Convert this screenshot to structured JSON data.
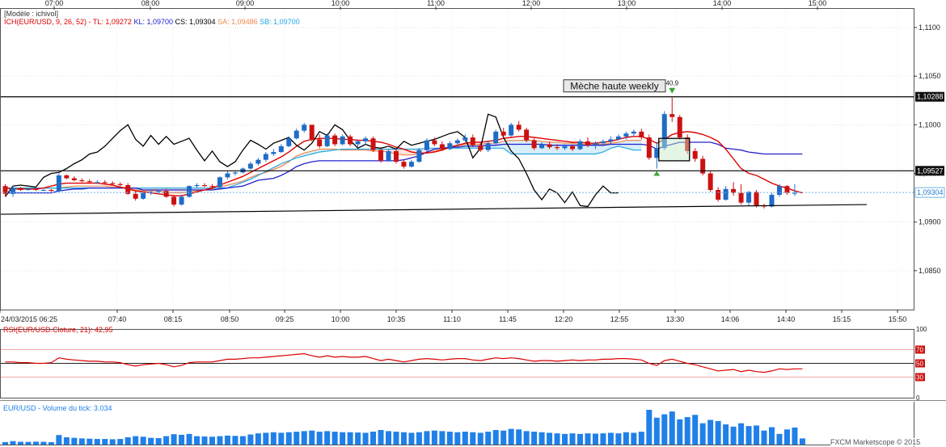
{
  "header": {
    "model_label": "[Modèle : ichivol]",
    "ichimoku_prefix": "ICH(EUR/USD, 9, 26, 52) -",
    "tl": "TL: 1,09272",
    "kl": "KL: 1,09700",
    "cs": "CS: 1,09304",
    "sa": "SA: 1,09486",
    "sb": "SB: 1,09700"
  },
  "colors": {
    "tenkan": "#dd0000",
    "kijun": "#2222cc",
    "chikou": "#000000",
    "span_a": "#f08850",
    "span_b": "#22a8e0",
    "bull": "#1e6cc8",
    "bear": "#cc1111",
    "rsi": "#dd0000",
    "volume": "#2080e8",
    "kumo_bull": "#d8eef8",
    "kumo_bear": "#fbe2dc"
  },
  "annotation": {
    "box_label": "Mèche haute weekly",
    "fractal_label": "40,9"
  },
  "top_time_labels": [
    "07:00",
    "08:00",
    "09:00",
    "10:00",
    "11:00",
    "12:00",
    "13:00",
    "14:00",
    "15:00"
  ],
  "bottom_time_labels": [
    "24/03/2015 06:25",
    "07:40",
    "08:15",
    "08:50",
    "09:25",
    "10:00",
    "10:35",
    "11:10",
    "11:45",
    "12:20",
    "12:55",
    "13:30",
    "14:06",
    "14:40",
    "15:15",
    "15:50"
  ],
  "price_axis": {
    "ylim": [
      1.081,
      1.112
    ],
    "ticks": [
      "1,1100",
      "1,1050",
      "1,1000",
      "1,0950",
      "1,0900",
      "1,0850"
    ],
    "levels": [
      {
        "name": "weekly-high",
        "value": 1.10288,
        "label": "1,10288"
      },
      {
        "name": "support",
        "value": 1.09527,
        "label": "1,09527"
      },
      {
        "name": "current",
        "value": 1.09304,
        "label": "1,09304"
      }
    ]
  },
  "rsi_panel": {
    "label": "RSI(EUR/USD.Cloture, 21): 42,95",
    "ylim": [
      0,
      100
    ],
    "ticks": [
      "100",
      "70",
      "50",
      "30",
      "0"
    ],
    "levels": [
      70,
      50,
      30
    ]
  },
  "volume_panel": {
    "label": "EUR/USD - Volume du tick: 3.034",
    "zero_tick": "0",
    "copyright": "FXCM Marketscope © 2015"
  },
  "chart_data": {
    "type": "candlestick",
    "symbol": "EUR/USD",
    "timeframe_minutes": 5,
    "start": "24/03/2015 06:25",
    "ohlc": [
      [
        1.0937,
        1.0939,
        1.0927,
        1.0929
      ],
      [
        1.0929,
        1.0937,
        1.0926,
        1.0935
      ],
      [
        1.0935,
        1.0936,
        1.0932,
        1.0933
      ],
      [
        1.0933,
        1.0935,
        1.0932,
        1.0934
      ],
      [
        1.0934,
        1.0935,
        1.0932,
        1.0933
      ],
      [
        1.0933,
        1.0934,
        1.0932,
        1.0933
      ],
      [
        1.0933,
        1.0934,
        1.0931,
        1.0932
      ],
      [
        1.0932,
        1.095,
        1.0931,
        1.0948
      ],
      [
        1.0948,
        1.0949,
        1.0944,
        1.0945
      ],
      [
        1.0945,
        1.0947,
        1.0942,
        1.0943
      ],
      [
        1.0943,
        1.0945,
        1.0941,
        1.0942
      ],
      [
        1.0942,
        1.0944,
        1.094,
        1.0941
      ],
      [
        1.0941,
        1.0943,
        1.094,
        1.0941
      ],
      [
        1.0941,
        1.0943,
        1.0939,
        1.094
      ],
      [
        1.094,
        1.0942,
        1.0938,
        1.0939
      ],
      [
        1.0939,
        1.0941,
        1.0937,
        1.0938
      ],
      [
        1.0938,
        1.094,
        1.0928,
        1.0929
      ],
      [
        1.0929,
        1.0932,
        1.0922,
        1.0924
      ],
      [
        1.0924,
        1.0931,
        1.0923,
        1.093
      ],
      [
        1.093,
        1.0932,
        1.0928,
        1.0931
      ],
      [
        1.0931,
        1.0933,
        1.0929,
        1.0932
      ],
      [
        1.0932,
        1.0934,
        1.0925,
        1.0926
      ],
      [
        1.0926,
        1.0928,
        1.0916,
        1.0918
      ],
      [
        1.0918,
        1.0928,
        1.0917,
        1.0926
      ],
      [
        1.0926,
        1.0938,
        1.0925,
        1.0937
      ],
      [
        1.0937,
        1.094,
        1.0935,
        1.0938
      ],
      [
        1.0938,
        1.094,
        1.0936,
        1.0937
      ],
      [
        1.0937,
        1.0939,
        1.0934,
        1.0936
      ],
      [
        1.0936,
        1.0947,
        1.0935,
        1.0946
      ],
      [
        1.0946,
        1.0952,
        1.0944,
        1.095
      ],
      [
        1.095,
        1.0953,
        1.0948,
        1.0951
      ],
      [
        1.0951,
        1.0956,
        1.095,
        1.0955
      ],
      [
        1.0955,
        1.0962,
        1.0954,
        1.096
      ],
      [
        1.096,
        1.0966,
        1.0958,
        1.0964
      ],
      [
        1.0964,
        1.0972,
        1.0962,
        1.097
      ],
      [
        1.097,
        1.0975,
        1.0968,
        1.0972
      ],
      [
        1.0972,
        1.098,
        1.0971,
        1.0978
      ],
      [
        1.0978,
        1.0988,
        1.0977,
        1.0986
      ],
      [
        1.0986,
        1.0996,
        1.0985,
        1.0994
      ],
      [
        1.0994,
        1.1002,
        1.0992,
        1.1
      ],
      [
        1.1,
        1.0998,
        1.0983,
        1.0985
      ],
      [
        1.0985,
        1.099,
        1.0976,
        1.0978
      ],
      [
        1.0978,
        1.0991,
        1.0977,
        1.0989
      ],
      [
        1.0989,
        1.0991,
        1.0978,
        1.098
      ],
      [
        1.098,
        1.099,
        1.0979,
        1.0988
      ],
      [
        1.0988,
        1.099,
        1.0978,
        1.098
      ],
      [
        1.098,
        1.0985,
        1.0977,
        1.0983
      ],
      [
        1.0983,
        1.0988,
        1.0979,
        1.0986
      ],
      [
        1.0986,
        1.0988,
        1.0972,
        1.0974
      ],
      [
        1.0974,
        1.0976,
        1.0961,
        1.0963
      ],
      [
        1.0963,
        1.0975,
        1.0962,
        1.0973
      ],
      [
        1.0973,
        1.0975,
        1.096,
        1.0962
      ],
      [
        1.0962,
        1.0964,
        1.0955,
        1.0957
      ],
      [
        1.0957,
        1.0964,
        1.0956,
        1.0962
      ],
      [
        1.0962,
        1.0976,
        1.0961,
        1.0974
      ],
      [
        1.0974,
        1.0986,
        1.0972,
        1.0984
      ],
      [
        1.0984,
        1.0987,
        1.0978,
        1.098
      ],
      [
        1.098,
        1.0983,
        1.0973,
        1.0975
      ],
      [
        1.0975,
        1.0983,
        1.0974,
        1.0981
      ],
      [
        1.0981,
        1.0986,
        1.0978,
        1.0984
      ],
      [
        1.0984,
        1.099,
        1.0982,
        1.0987
      ],
      [
        1.0987,
        1.099,
        1.0977,
        1.0979
      ],
      [
        1.0979,
        1.0982,
        1.0972,
        1.0974
      ],
      [
        1.0974,
        1.0984,
        1.0972,
        1.0981
      ],
      [
        1.0981,
        1.0995,
        1.098,
        1.0993
      ],
      [
        1.0993,
        1.0997,
        1.0987,
        1.0989
      ],
      [
        1.0989,
        1.1002,
        1.0988,
        1.1
      ],
      [
        1.1,
        1.1004,
        1.0993,
        1.0995
      ],
      [
        1.0995,
        1.0997,
        1.0982,
        1.0984
      ],
      [
        1.0984,
        1.0986,
        1.0974,
        1.0976
      ],
      [
        1.0976,
        1.0982,
        1.0975,
        1.098
      ],
      [
        1.098,
        1.0983,
        1.0975,
        1.0977
      ],
      [
        1.0977,
        1.098,
        1.0974,
        1.0976
      ],
      [
        1.0976,
        1.098,
        1.0974,
        1.0978
      ],
      [
        1.0978,
        1.098,
        1.0973,
        1.0975
      ],
      [
        1.0975,
        1.0985,
        1.0974,
        1.0983
      ],
      [
        1.0983,
        1.0987,
        1.0977,
        1.0979
      ],
      [
        1.0979,
        1.0983,
        1.0975,
        1.0981
      ],
      [
        1.0981,
        1.0985,
        1.0978,
        1.0983
      ],
      [
        1.0983,
        1.0988,
        1.098,
        1.0985
      ],
      [
        1.0985,
        1.099,
        1.0984,
        1.0988
      ],
      [
        1.0988,
        1.0993,
        1.0985,
        1.0991
      ],
      [
        1.0991,
        1.0995,
        1.0988,
        1.0993
      ],
      [
        1.0993,
        1.0996,
        1.0985,
        1.0987
      ],
      [
        1.0987,
        1.099,
        1.0964,
        1.0966
      ],
      [
        1.0966,
        1.0982,
        1.0955,
        1.0976
      ],
      [
        1.0976,
        1.1014,
        1.0974,
        1.1011
      ],
      [
        1.1011,
        1.1028,
        1.1003,
        1.1008
      ],
      [
        1.1008,
        1.101,
        1.0985,
        1.0987
      ],
      [
        1.0987,
        1.099,
        1.097,
        1.0973
      ],
      [
        1.0973,
        1.0976,
        1.0962,
        1.0965
      ],
      [
        1.0965,
        1.0968,
        1.0948,
        1.095
      ],
      [
        1.095,
        1.0953,
        1.0931,
        1.0933
      ],
      [
        1.0933,
        1.0936,
        1.0921,
        1.0923
      ],
      [
        1.0923,
        1.0937,
        1.0922,
        1.0934
      ],
      [
        1.0934,
        1.0941,
        1.0927,
        1.093
      ],
      [
        1.093,
        1.0939,
        1.0918,
        1.092
      ],
      [
        1.092,
        1.0932,
        1.0917,
        1.0931
      ],
      [
        1.0931,
        1.0933,
        1.0915,
        1.0917
      ],
      [
        1.0917,
        1.0919,
        1.0914,
        1.0916
      ],
      [
        1.0916,
        1.093,
        1.0915,
        1.0928
      ],
      [
        1.0928,
        1.0939,
        1.0926,
        1.0937
      ],
      [
        1.0937,
        1.0938,
        1.0928,
        1.093
      ],
      [
        1.093,
        1.0939,
        1.0927,
        1.093
      ]
    ],
    "tenkan": [
      1.0935,
      1.0934,
      1.0934,
      1.0934,
      1.0934,
      1.0935,
      1.0937,
      1.0939,
      1.094,
      1.094,
      1.094,
      1.094,
      1.094,
      1.0939,
      1.0938,
      1.0936,
      1.0934,
      1.0932,
      1.0931,
      1.093,
      1.0929,
      1.0928,
      1.0927,
      1.0927,
      1.0929,
      1.0931,
      1.0933,
      1.0935,
      1.0938,
      1.0941,
      1.0944,
      1.0947,
      1.0951,
      1.0955,
      1.0959,
      1.0963,
      1.0967,
      1.0972,
      1.0978,
      1.0983,
      1.0985,
      1.0986,
      1.0986,
      1.0986,
      1.0985,
      1.0985,
      1.0984,
      1.0984,
      1.0983,
      1.0982,
      1.098,
      1.0977,
      1.0975,
      1.0972,
      1.0971,
      1.0971,
      1.0972,
      1.0974,
      1.0977,
      1.0979,
      1.0981,
      1.0982,
      1.0982,
      1.0983,
      1.0984,
      1.0986,
      1.0987,
      1.0988,
      1.0988,
      1.0987,
      1.0986,
      1.0985,
      1.0984,
      1.0983,
      1.0982,
      1.0982,
      1.0981,
      1.0981,
      1.0982,
      1.0983,
      1.0985,
      1.0987,
      1.0988,
      1.0988,
      1.0985,
      1.0981,
      1.0985,
      1.099,
      1.0992,
      1.0993,
      1.0992,
      1.099,
      1.0987,
      1.0983,
      1.0975,
      1.0965,
      1.0955,
      1.095,
      1.0948,
      1.0944,
      1.094,
      1.0937,
      1.0935,
      1.0932,
      1.093
    ],
    "kijun": [
      1.093,
      1.093,
      1.093,
      1.093,
      1.093,
      1.093,
      1.093,
      1.0932,
      1.0933,
      1.0934,
      1.0934,
      1.0935,
      1.0935,
      1.0935,
      1.0935,
      1.0935,
      1.0935,
      1.0935,
      1.0933,
      1.0933,
      1.0933,
      1.0933,
      1.0933,
      1.0933,
      1.0933,
      1.0933,
      1.0933,
      1.0933,
      1.0934,
      1.0935,
      1.0936,
      1.0937,
      1.094,
      1.0943,
      1.0944,
      1.0945,
      1.0948,
      1.0952,
      1.0957,
      1.096,
      1.0962,
      1.0963,
      1.0963,
      1.0963,
      1.0963,
      1.0963,
      1.0963,
      1.0963,
      1.0963,
      1.0963,
      1.0963,
      1.0963,
      1.0964,
      1.0966,
      1.0968,
      1.0972,
      1.0975,
      1.0976,
      1.0977,
      1.0977,
      1.0978,
      1.0978,
      1.0978,
      1.0979,
      1.0979,
      1.098,
      1.098,
      1.098,
      1.098,
      1.098,
      1.098,
      1.0979,
      1.0979,
      1.0979,
      1.0979,
      1.0979,
      1.0979,
      1.0979,
      1.0979,
      1.098,
      1.098,
      1.098,
      1.098,
      1.098,
      1.0979,
      1.0975,
      1.0978,
      1.098,
      1.0982,
      1.0982,
      1.0982,
      1.0982,
      1.0982,
      1.098,
      1.0976,
      1.0975,
      1.0974,
      1.0972,
      1.0971,
      1.097,
      1.097,
      1.097,
      1.097,
      1.097,
      1.097
    ],
    "chikou_offset": -26,
    "senkou_offset": 26,
    "span_a": [
      1.0935,
      1.0934,
      1.0934,
      1.0934,
      1.0934,
      1.0935,
      1.0935,
      1.0935,
      1.0936,
      1.0937,
      1.0937,
      1.0937,
      1.0937,
      1.0937,
      1.0936,
      1.0936,
      1.0935,
      1.0933,
      1.0932,
      1.0932,
      1.0932,
      1.093,
      1.093,
      1.093,
      1.0931,
      1.0932,
      1.0933,
      1.0934,
      1.0936,
      1.0938,
      1.094,
      1.0942,
      1.0946,
      1.0949,
      1.0951,
      1.0954,
      1.0957,
      1.0962,
      1.0968,
      1.0971,
      1.0973,
      1.0975,
      1.0975,
      1.0975,
      1.0974,
      1.0974,
      1.0974,
      1.0974,
      1.0973,
      1.0973,
      1.0972,
      1.097,
      1.0969,
      1.0969,
      1.097,
      1.0971,
      1.0973,
      1.0975,
      1.0977,
      1.0978,
      1.098,
      1.098,
      1.098,
      1.0981,
      1.0981,
      1.0983,
      1.0984,
      1.0984,
      1.0984,
      1.0984,
      1.0983,
      1.0982,
      1.0982,
      1.0981,
      1.0981,
      1.098,
      1.098,
      1.098,
      1.098,
      1.0981,
      1.0982,
      1.0984,
      1.0984,
      1.0984
    ],
    "span_b": [
      1.0935,
      1.0935,
      1.0935,
      1.0935,
      1.0935,
      1.0935,
      1.0935,
      1.0935,
      1.0935,
      1.0935,
      1.0935,
      1.0935,
      1.0935,
      1.0935,
      1.0935,
      1.0935,
      1.0935,
      1.0935,
      1.0935,
      1.0935,
      1.0935,
      1.0935,
      1.0935,
      1.0935,
      1.0935,
      1.0935,
      1.0935,
      1.0935,
      1.0935,
      1.0935,
      1.0938,
      1.0941,
      1.0944,
      1.0948,
      1.0952,
      1.0956,
      1.096,
      1.0963,
      1.0966,
      1.0968,
      1.097,
      1.0972,
      1.0973,
      1.0974,
      1.0975,
      1.0975,
      1.0975,
      1.0975,
      1.0975,
      1.0975,
      1.0975,
      1.0975,
      1.0975,
      1.0975,
      1.0975,
      1.0976,
      1.0976,
      1.0976,
      1.0976,
      1.0976,
      1.0976,
      1.0976,
      1.0976,
      1.0976,
      1.0976,
      1.0976,
      1.097,
      1.097,
      1.097,
      1.097,
      1.097,
      1.097,
      1.097,
      1.097,
      1.097,
      1.097,
      1.097,
      1.097,
      1.0972,
      1.0976,
      1.0978,
      1.0976,
      1.0974,
      1.0974
    ],
    "rsi": [
      52,
      52,
      51,
      51,
      50,
      50,
      51,
      58,
      56,
      55,
      54,
      53,
      53,
      52,
      52,
      51,
      48,
      46,
      48,
      49,
      50,
      48,
      45,
      47,
      51,
      52,
      52,
      52,
      54,
      56,
      56,
      57,
      58,
      58,
      59,
      60,
      61,
      62,
      63,
      64,
      61,
      59,
      61,
      59,
      60,
      59,
      59,
      60,
      57,
      54,
      56,
      54,
      52,
      54,
      56,
      57,
      56,
      55,
      56,
      57,
      57,
      55,
      54,
      56,
      58,
      57,
      58,
      57,
      55,
      53,
      54,
      54,
      53,
      54,
      55,
      54,
      55,
      55,
      56,
      56,
      57,
      57,
      56,
      55,
      50,
      47,
      54,
      56,
      53,
      50,
      48,
      45,
      42,
      39,
      40,
      41,
      38,
      40,
      38,
      37,
      39,
      42,
      41,
      42,
      42
    ],
    "volume": [
      450,
      620,
      500,
      480,
      520,
      500,
      430,
      1700,
      1300,
      1200,
      1100,
      1050,
      1000,
      1000,
      950,
      1000,
      1300,
      1500,
      1400,
      1200,
      1150,
      1500,
      1850,
      1750,
      1900,
      1500,
      1450,
      1400,
      1500,
      1600,
      1550,
      1500,
      1800,
      2000,
      2100,
      2200,
      2100,
      2200,
      2300,
      2400,
      2500,
      2300,
      2400,
      2300,
      2200,
      2200,
      2150,
      2100,
      2300,
      2600,
      2400,
      2300,
      2200,
      2100,
      2200,
      2400,
      2500,
      2400,
      2300,
      2200,
      2300,
      2200,
      2100,
      2300,
      2600,
      2500,
      2800,
      2700,
      2400,
      2300,
      2200,
      2100,
      2000,
      1900,
      2000,
      1900,
      2000,
      1950,
      2000,
      2100,
      2000,
      2200,
      2100,
      2300,
      6200,
      4800,
      5400,
      5900,
      4500,
      4900,
      5300,
      3800,
      4400,
      4200,
      3600,
      3200,
      3800,
      3300,
      3400,
      2500,
      3100,
      1900,
      2700,
      3034,
      1100
    ],
    "ylim": [
      1.081,
      1.112
    ],
    "xlabel": "",
    "ylabel": "",
    "grid": true
  }
}
